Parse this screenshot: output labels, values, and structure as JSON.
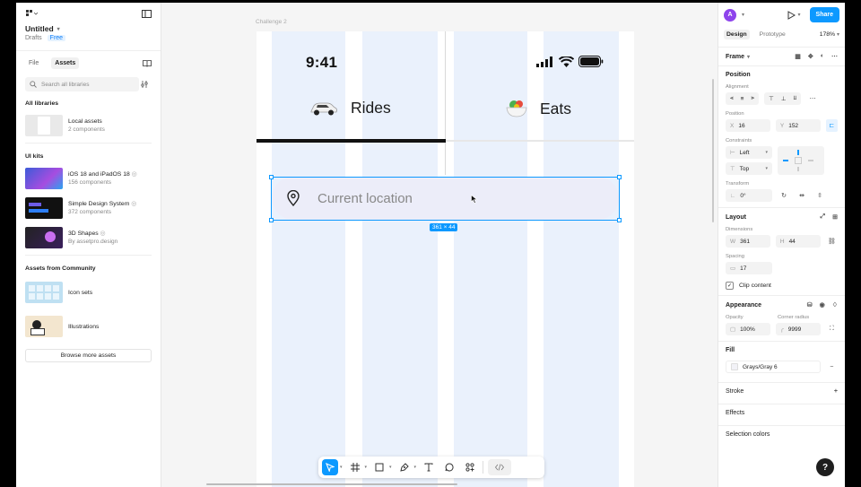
{
  "file": {
    "title": "Untitled",
    "location": "Drafts",
    "plan": "Free"
  },
  "left_tabs": [
    "File",
    "Assets"
  ],
  "search": {
    "placeholder": "Search all libraries"
  },
  "all_libraries": {
    "heading": "All libraries",
    "local": {
      "name": "Local assets",
      "meta": "2 components"
    }
  },
  "ui_kits": {
    "heading": "UI kits",
    "items": [
      {
        "name": "iOS 18 and iPadOS 18",
        "meta": "156 components",
        "icon": "verified-icon"
      },
      {
        "name": "Simple Design System",
        "meta": "372 components",
        "icon": "verified-icon"
      },
      {
        "name": "3D Shapes",
        "meta": "By assetpro.design",
        "icon": "verified-icon"
      }
    ]
  },
  "community": {
    "heading": "Assets from Community",
    "items": [
      {
        "name": "Icon sets"
      },
      {
        "name": "Illustrations"
      }
    ],
    "browse_label": "Browse more assets"
  },
  "canvas": {
    "frame_label": "Challenge 2",
    "status_time": "9:41",
    "tabs": [
      {
        "label": "Rides"
      },
      {
        "label": "Eats"
      }
    ],
    "location_placeholder": "Current location",
    "selection_size": "361 × 44"
  },
  "right": {
    "avatar_letter": "A",
    "share_label": "Share",
    "tabs": [
      "Design",
      "Prototype"
    ],
    "zoom": "178%",
    "frame_label": "Frame",
    "position": {
      "heading": "Position",
      "alignment_label": "Alignment",
      "position_label": "Position",
      "x": "16",
      "y": "152",
      "constraints_label": "Constraints",
      "constraint_h": "Left",
      "constraint_v": "Top",
      "transform_label": "Transform",
      "rotation": "0°"
    },
    "layout": {
      "heading": "Layout",
      "dimensions_label": "Dimensions",
      "w": "361",
      "h": "44",
      "spacing_label": "Spacing",
      "spacing": "17",
      "clip_label": "Clip content"
    },
    "appearance": {
      "heading": "Appearance",
      "opacity_label": "Opacity",
      "opacity": "100%",
      "radius_label": "Corner radius",
      "radius": "9999"
    },
    "fill": {
      "heading": "Fill",
      "value": "Grays/Gray 6"
    },
    "stroke": {
      "heading": "Stroke"
    },
    "effects": {
      "heading": "Effects"
    },
    "selection_colors": {
      "heading": "Selection colors"
    }
  },
  "colors": {
    "accent": "#0d99ff",
    "column": "#eaf1fc",
    "pill": "#ecedf9"
  }
}
